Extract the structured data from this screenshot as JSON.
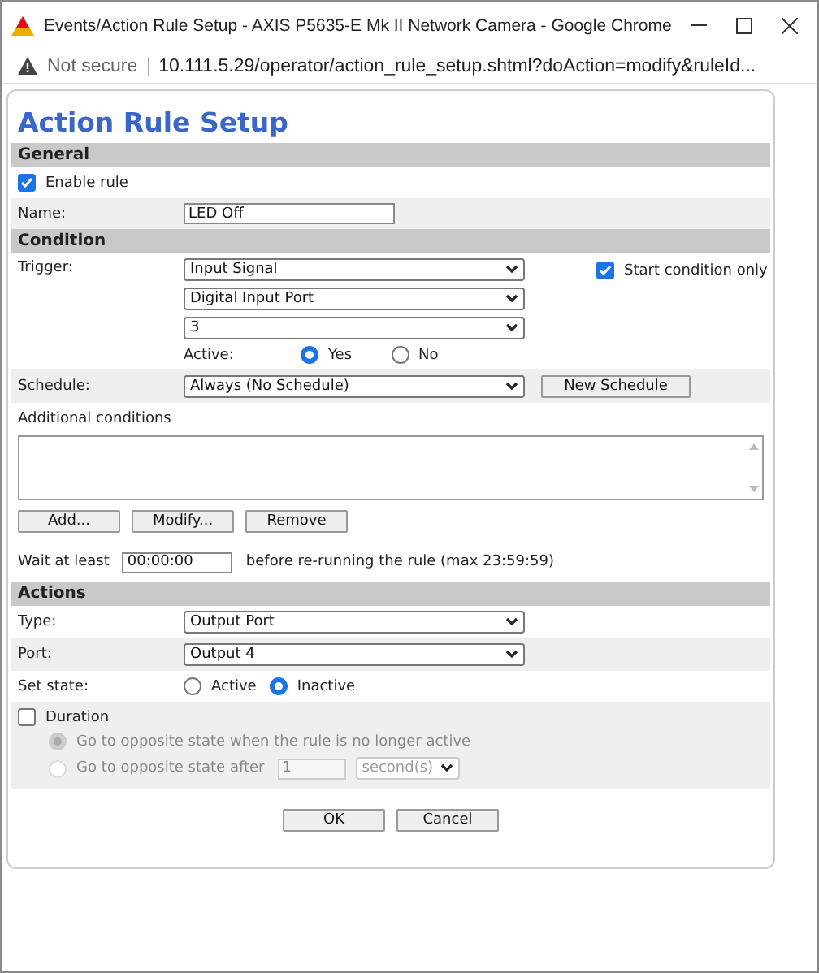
{
  "window": {
    "title": "Events/Action Rule Setup - AXIS P5635-E Mk II Network Camera - Google Chrome"
  },
  "address_bar": {
    "security": "Not secure",
    "url": "10.111.5.29/operator/action_rule_setup.shtml?doAction=modify&ruleId..."
  },
  "page_title": "Action Rule Setup",
  "general": {
    "header": "General",
    "enable_rule": {
      "label": "Enable rule",
      "checked": true
    },
    "name": {
      "label": "Name:",
      "value": "LED Off"
    }
  },
  "condition": {
    "header": "Condition",
    "trigger_label": "Trigger:",
    "trigger_selects": [
      "Input Signal",
      "Digital Input Port",
      "3"
    ],
    "start_condition_only": {
      "label": "Start condition only",
      "checked": true
    },
    "active_label": "Active:",
    "active_options": [
      {
        "label": "Yes",
        "selected": true
      },
      {
        "label": "No",
        "selected": false
      }
    ],
    "schedule": {
      "label": "Schedule:",
      "value": "Always (No Schedule)",
      "button": "New Schedule"
    },
    "additional_conditions_label": "Additional conditions",
    "list_buttons": [
      "Add...",
      "Modify...",
      "Remove"
    ],
    "wait": {
      "label": "Wait at least",
      "value": "00:00:00",
      "note": "before re-running the rule (max 23:59:59)"
    }
  },
  "actions": {
    "header": "Actions",
    "type": {
      "label": "Type:",
      "value": "Output Port"
    },
    "port": {
      "label": "Port:",
      "value": "Output 4"
    },
    "set_state_label": "Set state:",
    "set_state_options": [
      {
        "label": "Active",
        "selected": false
      },
      {
        "label": "Inactive",
        "selected": true
      }
    ],
    "duration": {
      "label": "Duration",
      "checked": false,
      "options": [
        {
          "label": "Go to opposite state when the rule is no longer active",
          "selected": true,
          "disabled": true
        },
        {
          "label": "Go to opposite state after",
          "selected": false,
          "disabled": true,
          "value": "1",
          "unit": "second(s)"
        }
      ]
    }
  },
  "buttons": [
    "OK",
    "Cancel"
  ]
}
